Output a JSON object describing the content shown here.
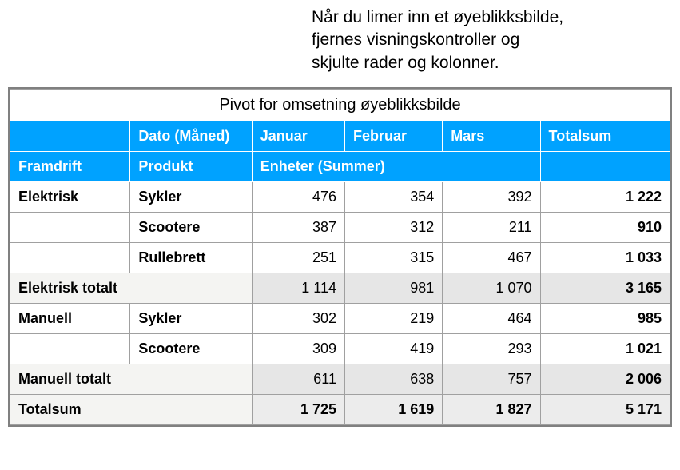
{
  "caption": {
    "line1": "Når du limer inn et øyeblikksbilde,",
    "line2": "fjernes visningskontroller og",
    "line3": "skjulte rader og kolonner."
  },
  "table": {
    "title": "Pivot for omsetning øyeblikksbilde",
    "header1": {
      "blank": "",
      "dato": "Dato (Måned)",
      "jan": "Januar",
      "feb": "Februar",
      "mar": "Mars",
      "tot": "Totalsum"
    },
    "header2": {
      "framdrift": "Framdrift",
      "produkt": "Produkt",
      "enheter": "Enheter (Summer)",
      "blank": ""
    },
    "rows": [
      {
        "group": "Elektrisk",
        "product": "Sykler",
        "jan": "476",
        "feb": "354",
        "mar": "392",
        "tot": "1 222"
      },
      {
        "group": "",
        "product": "Scootere",
        "jan": "387",
        "feb": "312",
        "mar": "211",
        "tot": "910"
      },
      {
        "group": "",
        "product": "Rullebrett",
        "jan": "251",
        "feb": "315",
        "mar": "467",
        "tot": "1 033"
      }
    ],
    "elektrisk_total": {
      "label": "Elektrisk totalt",
      "jan": "1 114",
      "feb": "981",
      "mar": "1 070",
      "tot": "3 165"
    },
    "rows2": [
      {
        "group": "Manuell",
        "product": "Sykler",
        "jan": "302",
        "feb": "219",
        "mar": "464",
        "tot": "985"
      },
      {
        "group": "",
        "product": "Scootere",
        "jan": "309",
        "feb": "419",
        "mar": "293",
        "tot": "1 021"
      }
    ],
    "manuell_total": {
      "label": "Manuell totalt",
      "jan": "611",
      "feb": "638",
      "mar": "757",
      "tot": "2 006"
    },
    "grand_total": {
      "label": "Totalsum",
      "jan": "1 725",
      "feb": "1 619",
      "mar": "1 827",
      "tot": "5 171"
    }
  }
}
